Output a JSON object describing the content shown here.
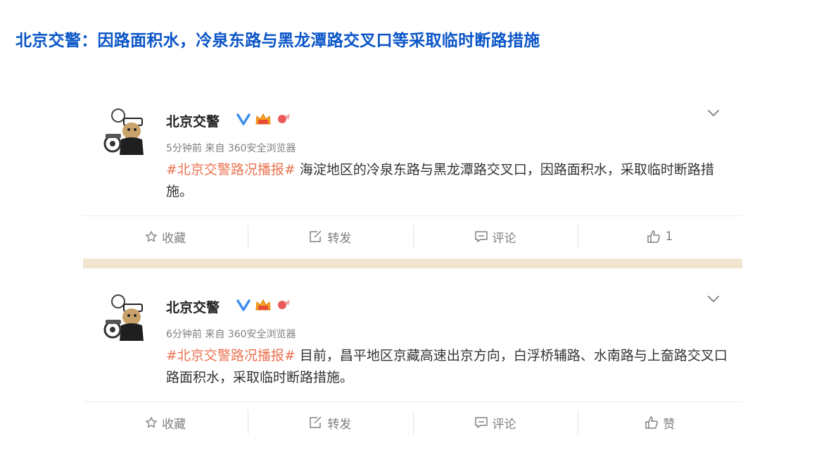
{
  "page": {
    "title": "北京交警：因路面积水，冷泉东路与黑龙潭路交叉口等采取临时断路措施"
  },
  "posts": [
    {
      "username": "北京交警",
      "time": "5分钟前",
      "source": "来自 360安全浏览器",
      "hashtag": "#北京交警路况播报#",
      "body": "海淀地区的冷泉东路与黑龙潭路交叉口，因路面积水，采取临时断路措施。",
      "actions": {
        "favorite": "收藏",
        "repost": "转发",
        "comment": "评论",
        "like": "1"
      }
    },
    {
      "username": "北京交警",
      "time": "6分钟前",
      "source": "来自 360安全浏览器",
      "hashtag": "#北京交警路况播报#",
      "body": "目前，昌平地区京藏高速出京方向，白浮桥辅路、水南路与上奤路交叉口路面积水，采取临时断路措施。",
      "actions": {
        "favorite": "收藏",
        "repost": "转发",
        "comment": "评论",
        "like": "赞"
      }
    }
  ],
  "colors": {
    "title": "#0a55c8",
    "hashtag": "#eb7350",
    "verified": "#3d8ef0",
    "separator": "#f3e8d3"
  },
  "icons": [
    "avatar",
    "verified-icon",
    "badge-icon",
    "chevron-down-icon",
    "star-icon",
    "edit-icon",
    "comment-icon",
    "thumbs-up-icon"
  ]
}
